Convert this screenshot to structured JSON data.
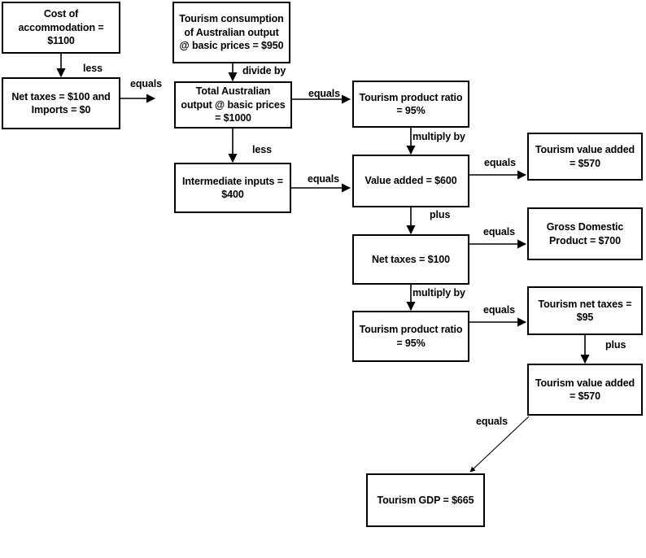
{
  "diagram": {
    "title": "Tourism GDP derivation flowchart",
    "stroke_color": "#000000",
    "background_color": "#ffffff",
    "nodes": [
      {
        "id": "cost_accommodation",
        "text": "Cost of\naccommodation =\n$1100"
      },
      {
        "id": "net_taxes_imports",
        "text": "Net taxes = $100 and\nImports = $0"
      },
      {
        "id": "tourism_consumption",
        "text": "Tourism consumption\nof Australian output\n@ basic prices = $950"
      },
      {
        "id": "total_output",
        "text": "Total Australian\noutput @ basic prices\n= $1000"
      },
      {
        "id": "intermediate_inputs",
        "text": "Intermediate inputs =\n$400"
      },
      {
        "id": "tourism_product_ratio_1",
        "text": "Tourism product ratio\n= 95%"
      },
      {
        "id": "value_added",
        "text": "Value added = $600"
      },
      {
        "id": "net_taxes",
        "text": "Net taxes = $100"
      },
      {
        "id": "tourism_product_ratio_2",
        "text": "Tourism product ratio\n= 95%"
      },
      {
        "id": "tourism_value_added_1",
        "text": "Tourism value added\n= $570"
      },
      {
        "id": "gross_domestic_product",
        "text": "Gross Domestic\nProduct = $700"
      },
      {
        "id": "tourism_net_taxes",
        "text": "Tourism net taxes =\n$95"
      },
      {
        "id": "tourism_value_added_2",
        "text": "Tourism value added\n= $570"
      },
      {
        "id": "tourism_gdp",
        "text": "Tourism GDP = $665"
      }
    ],
    "edge_labels": [
      {
        "id": "less_1",
        "text": "less"
      },
      {
        "id": "equals_1",
        "text": "equals"
      },
      {
        "id": "divide_by",
        "text": "divide by"
      },
      {
        "id": "equals_2",
        "text": "equals"
      },
      {
        "id": "less_2",
        "text": "less"
      },
      {
        "id": "multiply_by_1",
        "text": "multiply by"
      },
      {
        "id": "equals_3",
        "text": "equals"
      },
      {
        "id": "equals_4",
        "text": "equals"
      },
      {
        "id": "plus_1",
        "text": "plus"
      },
      {
        "id": "equals_5",
        "text": "equals"
      },
      {
        "id": "multiply_by_2",
        "text": "multiply by"
      },
      {
        "id": "equals_6",
        "text": "equals"
      },
      {
        "id": "plus_2",
        "text": "plus"
      },
      {
        "id": "equals_7",
        "text": "equals"
      }
    ]
  }
}
